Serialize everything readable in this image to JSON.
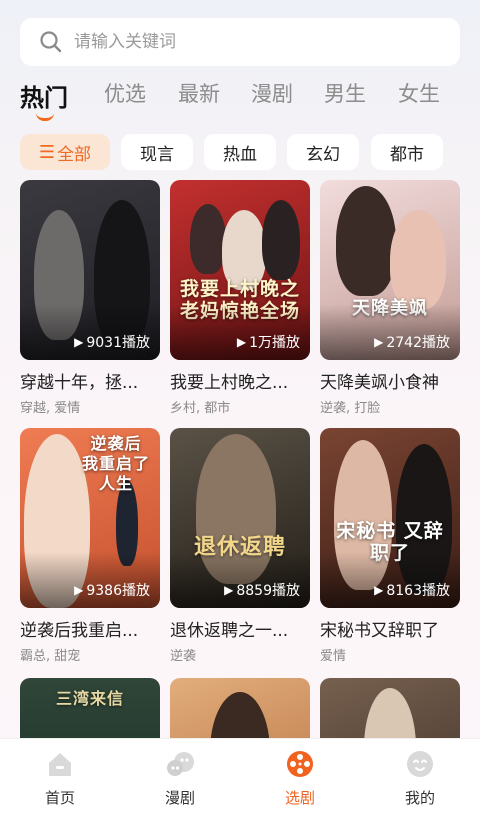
{
  "search": {
    "placeholder": "请输入关键词",
    "icon": "search-icon"
  },
  "tabs": [
    {
      "label": "热门",
      "active": true
    },
    {
      "label": "优选"
    },
    {
      "label": "最新"
    },
    {
      "label": "漫剧"
    },
    {
      "label": "男生"
    },
    {
      "label": "女生"
    }
  ],
  "chips": [
    {
      "icon": "☰",
      "label": "全部",
      "active": true
    },
    {
      "label": "现言"
    },
    {
      "label": "热血"
    },
    {
      "label": "玄幻"
    },
    {
      "label": "都市"
    }
  ],
  "cards": [
    {
      "title": "穿越十年，拯...",
      "tags": "穿越, 爱情",
      "plays": "9031播放",
      "poster_text": "",
      "colors": [
        "#2b2a2e",
        "#4d4a4d"
      ]
    },
    {
      "title": "我要上村晚之...",
      "tags": "乡村, 都市",
      "plays": "1万播放",
      "poster_text": "我要上村晚之 老妈惊艳全场",
      "colors": [
        "#b0282a",
        "#6e1113"
      ]
    },
    {
      "title": "天降美飒小食神",
      "tags": "逆袭, 打脸",
      "plays": "2742播放",
      "poster_text": "天降美飒",
      "colors": [
        "#e6c9c9",
        "#b6867f"
      ]
    },
    {
      "title": "逆袭后我重启...",
      "tags": "霸总, 甜宠",
      "plays": "9386播放",
      "poster_text": "逆袭后 我重启了 人生",
      "colors": [
        "#e7724a",
        "#c85334"
      ]
    },
    {
      "title": "退休返聘之一...",
      "tags": "逆袭",
      "plays": "8859播放",
      "poster_text": "退休返聘",
      "colors": [
        "#4a4338",
        "#2a241d"
      ]
    },
    {
      "title": "宋秘书又辞职了",
      "tags": "爱情",
      "plays": "8163播放",
      "poster_text": "宋秘书 又辞职了",
      "colors": [
        "#6a3b2c",
        "#3b1f17"
      ]
    },
    {
      "title": "",
      "tags": "",
      "plays": "",
      "poster_text": "三湾来信",
      "colors": [
        "#2f4438",
        "#1c2c23"
      ]
    },
    {
      "title": "",
      "tags": "",
      "plays": "",
      "poster_text": "",
      "colors": [
        "#d9a170",
        "#b46c3d"
      ]
    },
    {
      "title": "",
      "tags": "",
      "plays": "",
      "poster_text": "",
      "colors": [
        "#6c5446",
        "#3d2e26"
      ]
    }
  ],
  "bottom_nav": [
    {
      "label": "首页",
      "icon": "home-icon"
    },
    {
      "label": "漫剧",
      "icon": "comic-icon"
    },
    {
      "label": "选剧",
      "icon": "film-reel-icon",
      "active": true
    },
    {
      "label": "我的",
      "icon": "profile-icon"
    }
  ],
  "colors": {
    "accent": "#f0621e",
    "chip_active_bg": "#fbe6d6",
    "muted_text": "#8a8a8a"
  }
}
